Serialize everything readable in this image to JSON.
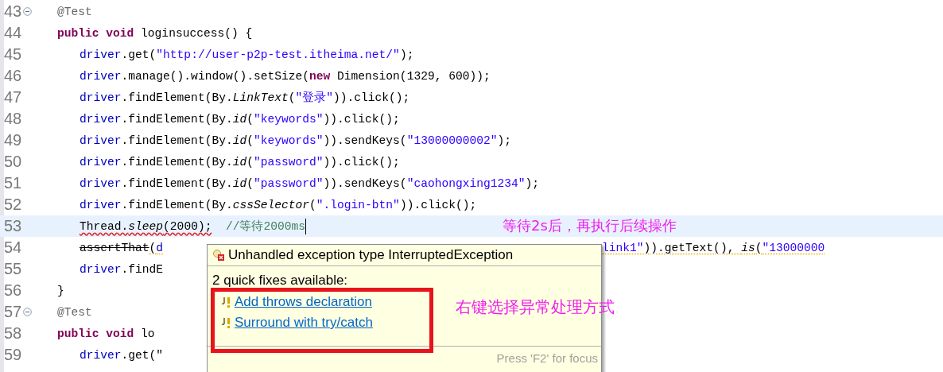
{
  "editor": {
    "lines": [
      {
        "number": "43",
        "kind": "decl",
        "foldable": true,
        "current": false,
        "caret": false,
        "tokens": [
          {
            "text": "@Test",
            "kind": "ann"
          }
        ]
      },
      {
        "number": "44",
        "kind": "decl",
        "foldable": false,
        "current": false,
        "caret": false,
        "tokens": [
          {
            "text": "public void",
            "kind": "kw"
          },
          {
            "text": " loginsuccess() {",
            "kind": "plain"
          }
        ]
      },
      {
        "number": "45",
        "kind": "stmt",
        "foldable": false,
        "current": false,
        "caret": false,
        "tokens": [
          {
            "text": "driver",
            "kind": "field"
          },
          {
            "text": ".get(",
            "kind": "plain"
          },
          {
            "text": "\"http://user-p2p-test.itheima.net/\"",
            "kind": "str"
          },
          {
            "text": ");",
            "kind": "plain"
          }
        ]
      },
      {
        "number": "46",
        "kind": "stmt",
        "foldable": false,
        "current": false,
        "caret": false,
        "tokens": [
          {
            "text": "driver",
            "kind": "field"
          },
          {
            "text": ".manage().window().setSize(",
            "kind": "plain"
          },
          {
            "text": "new",
            "kind": "kw"
          },
          {
            "text": " Dimension(1329, 600));",
            "kind": "plain"
          }
        ]
      },
      {
        "number": "47",
        "kind": "stmt",
        "foldable": false,
        "current": false,
        "caret": false,
        "tokens": [
          {
            "text": "driver",
            "kind": "field"
          },
          {
            "text": ".findElement(By.",
            "kind": "plain"
          },
          {
            "text": "LinkText",
            "kind": "it"
          },
          {
            "text": "(",
            "kind": "plain"
          },
          {
            "text": "\"登录\"",
            "kind": "str"
          },
          {
            "text": ")).click();",
            "kind": "plain"
          }
        ]
      },
      {
        "number": "48",
        "kind": "stmt",
        "foldable": false,
        "current": false,
        "caret": false,
        "tokens": [
          {
            "text": "driver",
            "kind": "field"
          },
          {
            "text": ".findElement(By.",
            "kind": "plain"
          },
          {
            "text": "id",
            "kind": "it"
          },
          {
            "text": "(",
            "kind": "plain"
          },
          {
            "text": "\"keywords\"",
            "kind": "str"
          },
          {
            "text": ")).click();",
            "kind": "plain"
          }
        ]
      },
      {
        "number": "49",
        "kind": "stmt",
        "foldable": false,
        "current": false,
        "caret": false,
        "tokens": [
          {
            "text": "driver",
            "kind": "field"
          },
          {
            "text": ".findElement(By.",
            "kind": "plain"
          },
          {
            "text": "id",
            "kind": "it"
          },
          {
            "text": "(",
            "kind": "plain"
          },
          {
            "text": "\"keywords\"",
            "kind": "str"
          },
          {
            "text": ")).sendKeys(",
            "kind": "plain"
          },
          {
            "text": "\"13000000002\"",
            "kind": "str"
          },
          {
            "text": ");",
            "kind": "plain"
          }
        ]
      },
      {
        "number": "50",
        "kind": "stmt",
        "foldable": false,
        "current": false,
        "caret": false,
        "tokens": [
          {
            "text": "driver",
            "kind": "field"
          },
          {
            "text": ".findElement(By.",
            "kind": "plain"
          },
          {
            "text": "id",
            "kind": "it"
          },
          {
            "text": "(",
            "kind": "plain"
          },
          {
            "text": "\"password\"",
            "kind": "str"
          },
          {
            "text": ")).click();",
            "kind": "plain"
          }
        ]
      },
      {
        "number": "51",
        "kind": "stmt",
        "foldable": false,
        "current": false,
        "caret": false,
        "tokens": [
          {
            "text": "driver",
            "kind": "field"
          },
          {
            "text": ".findElement(By.",
            "kind": "plain"
          },
          {
            "text": "id",
            "kind": "it"
          },
          {
            "text": "(",
            "kind": "plain"
          },
          {
            "text": "\"password\"",
            "kind": "str"
          },
          {
            "text": ")).sendKeys(",
            "kind": "plain"
          },
          {
            "text": "\"caohongxing1234\"",
            "kind": "str"
          },
          {
            "text": ");",
            "kind": "plain"
          }
        ]
      },
      {
        "number": "52",
        "kind": "stmt",
        "foldable": false,
        "current": false,
        "caret": false,
        "tokens": [
          {
            "text": "driver",
            "kind": "field"
          },
          {
            "text": ".findElement(By.",
            "kind": "plain"
          },
          {
            "text": "cssSelector",
            "kind": "it"
          },
          {
            "text": "(",
            "kind": "plain"
          },
          {
            "text": "\".login-btn\"",
            "kind": "str"
          },
          {
            "text": ")).click();",
            "kind": "plain"
          }
        ]
      },
      {
        "number": "53",
        "kind": "stmt",
        "foldable": false,
        "current": true,
        "caret": true,
        "tokens": [
          {
            "text": "Thread.",
            "kind": "err-plain"
          },
          {
            "text": "sleep",
            "kind": "err-it"
          },
          {
            "text": "(2000);",
            "kind": "err-plain"
          },
          {
            "text": "//等待2000ms",
            "kind": "cmt"
          }
        ],
        "note": "等待2s后，再执行后续操作"
      },
      {
        "number": "54",
        "kind": "stmt",
        "foldable": false,
        "current": false,
        "caret": false,
        "tokens": [
          {
            "text": "assertThat",
            "kind": "deprecated"
          },
          {
            "text": "(",
            "kind": "warn-plain"
          },
          {
            "text": "d",
            "kind": "warn-field"
          }
        ],
        "tail": [
          {
            "text": "link1\"",
            "kind": "warn-str"
          },
          {
            "text": ")).getText(), ",
            "kind": "warn-plain"
          },
          {
            "text": "is",
            "kind": "warn-it"
          },
          {
            "text": "(",
            "kind": "warn-plain"
          },
          {
            "text": "\"13000000",
            "kind": "warn-str"
          }
        ]
      },
      {
        "number": "55",
        "kind": "stmt",
        "foldable": false,
        "current": false,
        "caret": false,
        "tokens": [
          {
            "text": "driver",
            "kind": "field"
          },
          {
            "text": ".findE",
            "kind": "plain"
          }
        ]
      },
      {
        "number": "56",
        "kind": "decl",
        "foldable": false,
        "current": false,
        "caret": false,
        "tokens": [
          {
            "text": "}",
            "kind": "plain"
          }
        ]
      },
      {
        "number": "57",
        "kind": "decl",
        "foldable": true,
        "current": false,
        "caret": false,
        "tokens": [
          {
            "text": "@Test",
            "kind": "ann"
          }
        ]
      },
      {
        "number": "58",
        "kind": "decl",
        "foldable": false,
        "current": false,
        "caret": false,
        "tokens": [
          {
            "text": "public void",
            "kind": "kw"
          },
          {
            "text": " lo",
            "kind": "plain"
          }
        ]
      },
      {
        "number": "59",
        "kind": "stmt",
        "foldable": false,
        "current": false,
        "caret": false,
        "tokens": [
          {
            "text": "driver",
            "kind": "field"
          },
          {
            "text": ".get(\"",
            "kind": "plain"
          }
        ]
      }
    ]
  },
  "quick_fix_popup": {
    "problem": "Unhandled exception type InterruptedException",
    "summary": "2 quick fixes available:",
    "fixes": [
      {
        "label": "Add throws declaration"
      },
      {
        "label": "Surround with try/catch"
      }
    ],
    "footer": "Press 'F2' for focus"
  },
  "callout": "右键选择异常处理方式"
}
